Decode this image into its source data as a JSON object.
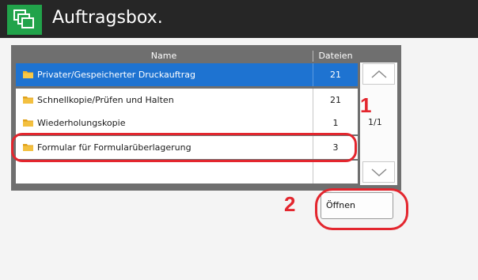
{
  "window": {
    "title": "Auftragsbox."
  },
  "table": {
    "headers": {
      "name": "Name",
      "count": "Dateien"
    },
    "rows": [
      {
        "name": "Privater/Gespeicherter Druckauftrag",
        "count": "21",
        "selected": true
      },
      {
        "name": "Schnellkopie/Prüfen und Halten",
        "count": "21",
        "selected": false
      },
      {
        "name": "Wiederholungskopie",
        "count": "1",
        "selected": false
      },
      {
        "name": "Formular für Formularüberlagerung",
        "count": "3",
        "selected": false
      }
    ]
  },
  "pagination": {
    "page": "1/1"
  },
  "actions": {
    "open_label": "Öffnen"
  },
  "callouts": {
    "one": "1",
    "two": "2"
  },
  "colors": {
    "accent": "#21a34a",
    "selection": "#1e73d1",
    "callout": "#e3262e",
    "titlebar": "#262626"
  },
  "icons": {
    "app": "job-box-icon",
    "row": "folder-icon",
    "scroll_up": "chevron-up-icon",
    "scroll_down": "chevron-down-icon"
  }
}
